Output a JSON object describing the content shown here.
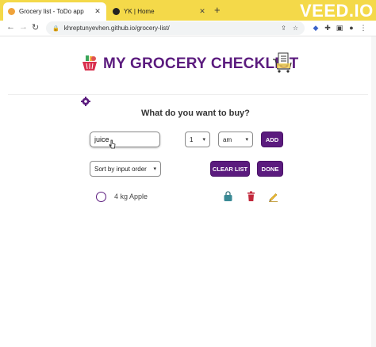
{
  "browser": {
    "tabs": [
      {
        "title": "Grocery list - ToDo app",
        "active": true
      },
      {
        "title": "YK | Home",
        "active": false
      }
    ],
    "new_tab_label": "+",
    "url": "khreptunyevhen.github.io/grocery-list/",
    "watermark": "VEED.IO"
  },
  "colors": {
    "brand": "#5b1b7e",
    "tabbar": "#f4d949"
  },
  "header": {
    "title": "MY GROCERY CHECKLIST"
  },
  "form": {
    "question": "What do you want to buy?",
    "item_value": "juice",
    "quantity_value": "1",
    "unit_value": "am",
    "add_label": "ADD",
    "sort_value": "Sort by input order",
    "clear_label": "CLEAR LIST",
    "done_label": "DONE"
  },
  "list": {
    "items": [
      {
        "text": "4 kg Apple",
        "checked": false
      }
    ]
  },
  "icons": [
    "basket-icon",
    "cart-checklist-icon",
    "gear-icon",
    "bag-icon",
    "trash-icon",
    "pencil-icon"
  ]
}
